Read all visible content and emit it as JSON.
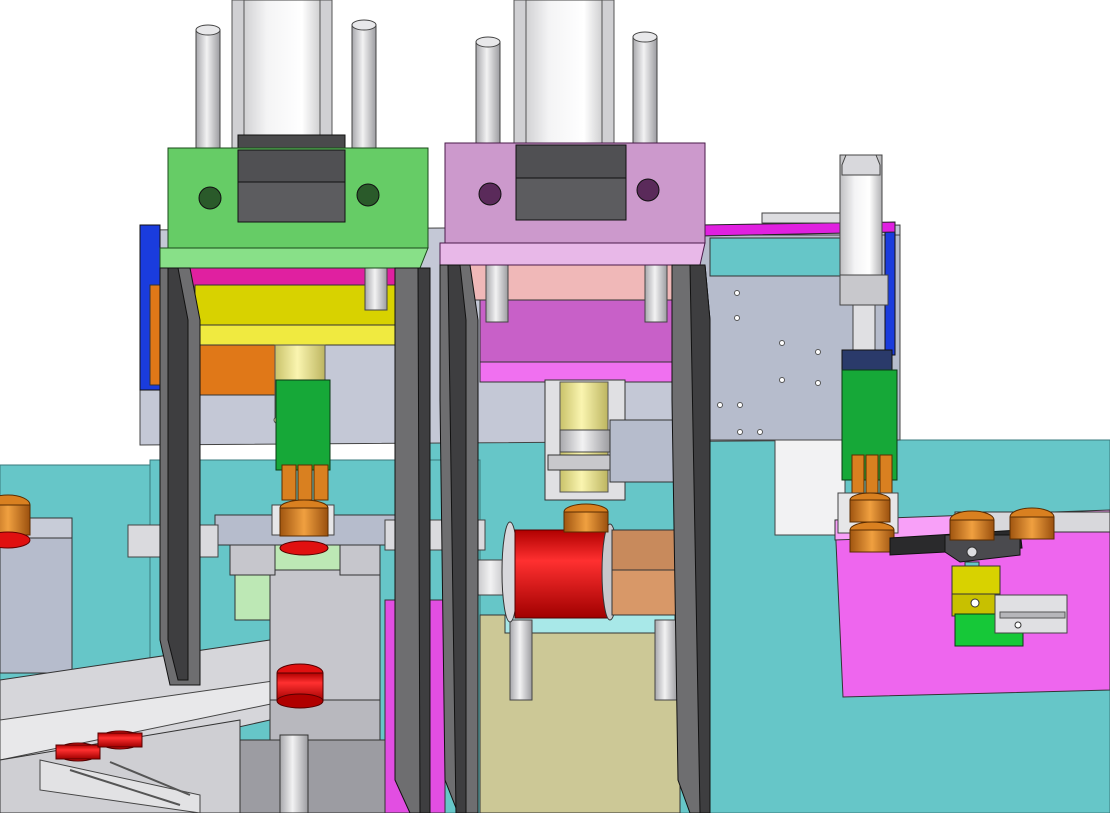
{
  "scene": {
    "subject": "press-assembly-cad-render",
    "components": [
      "left-press-head",
      "right-press-head",
      "cylinder-actuator",
      "red-coil-bobbin",
      "orange-cap-parts",
      "pick-place-gripper",
      "feed-rail",
      "magenta-side-table",
      "teal-base-plate",
      "gray-frame-columns"
    ]
  },
  "colors": {
    "background": "#ffffff",
    "teal_base": "#66c6c8",
    "green_plate": "#66cc66",
    "pink_plate": "#cc99cc",
    "yellow_block": "#d8d200",
    "magenta": "#ee55ee",
    "red_coil": "#e01010",
    "orange_parts": "#d98020",
    "frame_gray": "#6e6e70",
    "steel_light": "#e4e4e6",
    "panel_blue_gray": "#b6bccc",
    "khaki": "#ccc896",
    "blue_edge": "#1a3cdd"
  }
}
